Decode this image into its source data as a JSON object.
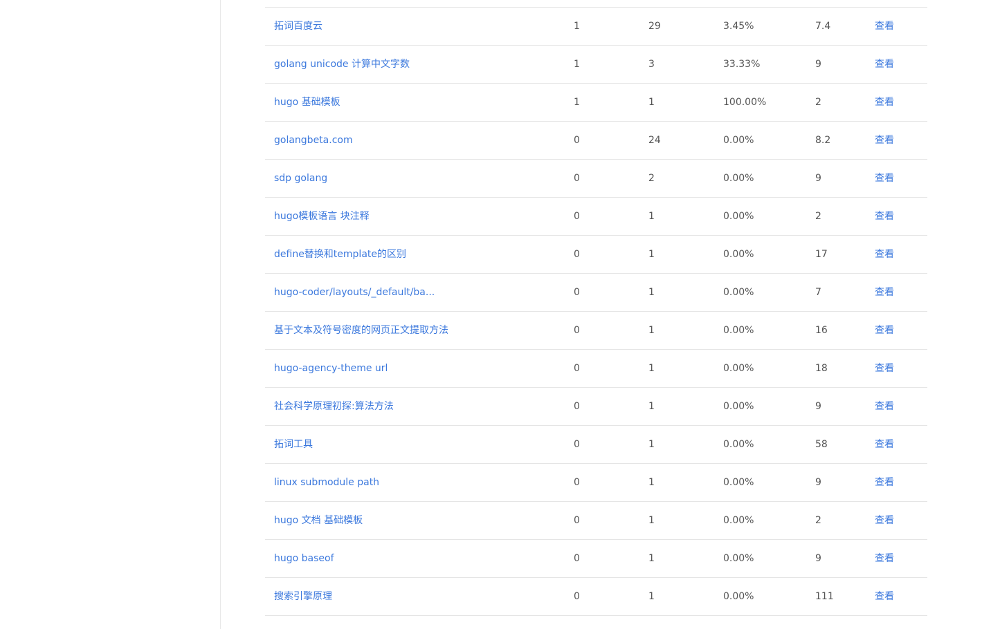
{
  "rows": [
    {
      "keyword": "拓词百度云",
      "a": "1",
      "b": "29",
      "rate": "3.45%",
      "d": "7.4",
      "action": "查看"
    },
    {
      "keyword": "golang unicode 计算中文字数",
      "a": "1",
      "b": "3",
      "rate": "33.33%",
      "d": "9",
      "action": "查看"
    },
    {
      "keyword": "hugo 基础模板",
      "a": "1",
      "b": "1",
      "rate": "100.00%",
      "d": "2",
      "action": "查看"
    },
    {
      "keyword": "golangbeta.com",
      "a": "0",
      "b": "24",
      "rate": "0.00%",
      "d": "8.2",
      "action": "查看"
    },
    {
      "keyword": "sdp golang",
      "a": "0",
      "b": "2",
      "rate": "0.00%",
      "d": "9",
      "action": "查看"
    },
    {
      "keyword": "hugo模板语言 块注释",
      "a": "0",
      "b": "1",
      "rate": "0.00%",
      "d": "2",
      "action": "查看"
    },
    {
      "keyword": "define替换和template的区别",
      "a": "0",
      "b": "1",
      "rate": "0.00%",
      "d": "17",
      "action": "查看"
    },
    {
      "keyword": "hugo-coder/layouts/_default/ba...",
      "a": "0",
      "b": "1",
      "rate": "0.00%",
      "d": "7",
      "action": "查看"
    },
    {
      "keyword": "基于文本及符号密度的网页正文提取方法",
      "a": "0",
      "b": "1",
      "rate": "0.00%",
      "d": "16",
      "action": "查看"
    },
    {
      "keyword": "hugo-agency-theme url",
      "a": "0",
      "b": "1",
      "rate": "0.00%",
      "d": "18",
      "action": "查看"
    },
    {
      "keyword": "社会科学原理初探:算法方法",
      "a": "0",
      "b": "1",
      "rate": "0.00%",
      "d": "9",
      "action": "查看"
    },
    {
      "keyword": "拓词工具",
      "a": "0",
      "b": "1",
      "rate": "0.00%",
      "d": "58",
      "action": "查看"
    },
    {
      "keyword": "linux submodule path",
      "a": "0",
      "b": "1",
      "rate": "0.00%",
      "d": "9",
      "action": "查看"
    },
    {
      "keyword": "hugo 文档 基础模板",
      "a": "0",
      "b": "1",
      "rate": "0.00%",
      "d": "2",
      "action": "查看"
    },
    {
      "keyword": "hugo baseof",
      "a": "0",
      "b": "1",
      "rate": "0.00%",
      "d": "9",
      "action": "查看"
    },
    {
      "keyword": "搜索引擎原理",
      "a": "0",
      "b": "1",
      "rate": "0.00%",
      "d": "111",
      "action": "查看"
    }
  ],
  "colors": {
    "link": "#3b78dd",
    "text": "#555555",
    "border": "#e5e5e5"
  }
}
